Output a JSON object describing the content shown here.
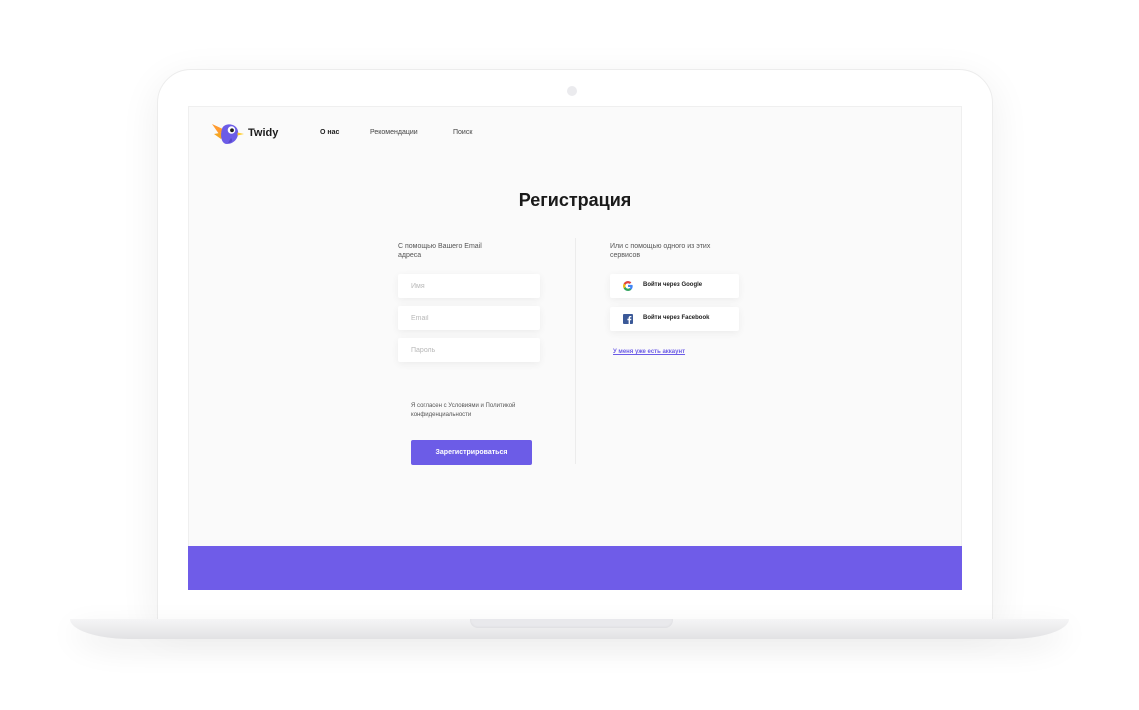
{
  "brand": {
    "name": "Twidy"
  },
  "nav": {
    "items": [
      "О нас",
      "Рекомендации",
      "Поиск"
    ]
  },
  "page": {
    "title": "Регистрация"
  },
  "email_section": {
    "caption_line1": "С помощью Вашего Email",
    "caption_line2": "адреса",
    "fields": {
      "name": {
        "placeholder": "Имя",
        "value": ""
      },
      "email": {
        "placeholder": "Email",
        "value": ""
      },
      "password": {
        "placeholder": "Пароль",
        "value": ""
      }
    },
    "consent_line1": "Я согласен с Условиями и Политикой",
    "consent_line2": "конфиденциальности",
    "submit_label": "Зарегистрироваться"
  },
  "services_section": {
    "caption_line1": "Или с помощью одного из этих",
    "caption_line2": "сервисов",
    "google_label": "Войти через Google",
    "facebook_label": "Войти через Facebook",
    "login_link": "У меня уже есть аккаунт"
  },
  "colors": {
    "accent": "#6c5ce7",
    "footer": "#6f5ce8",
    "screen_bg": "#fafafa",
    "facebook": "#3b5998"
  },
  "icons": [
    "bird-logo-icon",
    "google-icon",
    "facebook-icon"
  ]
}
